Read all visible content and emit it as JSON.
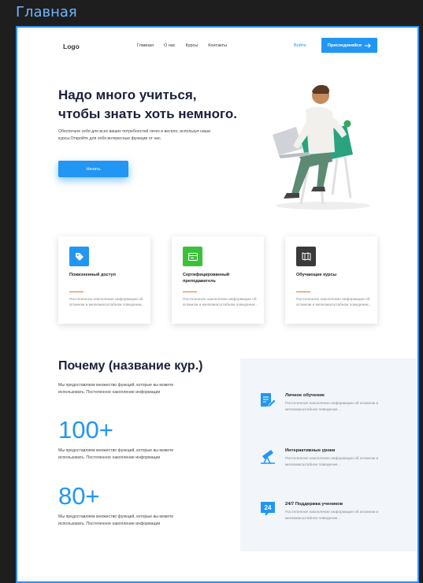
{
  "frame": {
    "title": "Главная"
  },
  "header": {
    "logo": "Logo",
    "nav": [
      "Главная",
      "О нас",
      "Курсы",
      "Контакты"
    ],
    "login": "Войти",
    "join": "Присоединяйся",
    "join_icon": "arrow-right-icon"
  },
  "hero": {
    "title_line1": "Надо много учиться,",
    "title_line2": "чтобы знать хоть немного.",
    "subtitle": "Обеспечьте себя для всех ваших потребностей легко и весело, используя наши курсы.Откройте для себя интересные функции от нас.",
    "cta": "Начать"
  },
  "cards": [
    {
      "title": "Пожизненный доступ",
      "desc": "Постепенное накопление информации об атомном и мелкомасштабном поведении...",
      "icon": "tag-icon",
      "color": "#2196f3"
    },
    {
      "title": "Сертифицированный преподаватель",
      "desc": "Постепенное накопление информации об атомном и мелкомасштабном поведении...",
      "icon": "certificate-icon",
      "color": "#3cc13b"
    },
    {
      "title": "Обучающие курсы",
      "desc": "Постепенное накопление информации об атомном и мелкомасштабном поведении...",
      "icon": "book-icon",
      "color": "#3a3a3a"
    }
  ],
  "why": {
    "title": "Почему (название кур.)",
    "subtitle": "Мы предоставляем множество функций, которые вы можете использовать. Постепенное накопление информации",
    "stats": [
      {
        "number": "100+",
        "desc": "Мы предоставляем множество функций, которые вы можете использовать. Постепенное накопление информации"
      },
      {
        "number": "80+",
        "desc": "Мы предоставляем множество функций, которые вы можете использовать. Постепенное накопление информации"
      }
    ],
    "features": [
      {
        "title": "Личное обучение",
        "desc": "Постепенное накопление информации об атомном и мелкомасштабное поведение...",
        "icon": "edit-document-icon"
      },
      {
        "title": "Интерактивные уроки",
        "desc": "Постепенное накопление информации об атомном и мелкомасштабное поведение...",
        "icon": "telescope-icon"
      },
      {
        "title": "24/7 Поддержка учеников",
        "desc": "Постепенное накопление информации об атомном и мелкомасштабное поведение...",
        "icon": "support-24-icon",
        "badge": "24"
      }
    ]
  },
  "colors": {
    "accent": "#2196f3",
    "heading": "#1b1f3b",
    "orange_line": "#f26b2a",
    "section_bg": "#f2f6fa"
  }
}
